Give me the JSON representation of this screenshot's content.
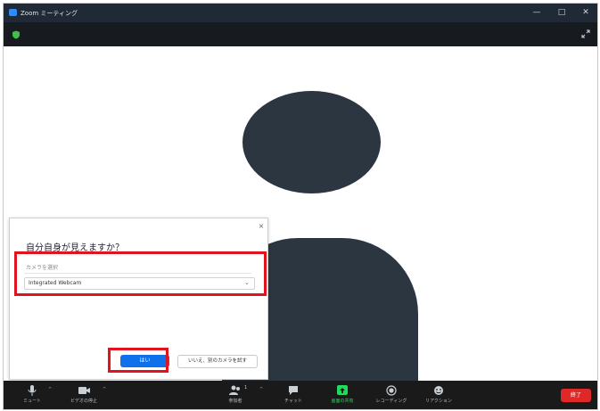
{
  "window": {
    "title": "Zoom ミーティング",
    "minimize_glyph": "—",
    "maximize_glyph": "□",
    "close_glyph": "✕"
  },
  "dialog": {
    "title": "自分自身が見えますか？",
    "select_label": "カメラを選択",
    "selected_camera": "Integrated Webcam",
    "yes_label": "はい",
    "other_camera_label": "いいえ、別のカメラを試す",
    "close_glyph": "×"
  },
  "toolbar": {
    "mute_label": "ミュート",
    "video_label": "ビデオの停止",
    "participants_label": "参加者",
    "participants_count": "1",
    "chat_label": "チャット",
    "share_label": "画面の共有",
    "record_label": "レコーディング",
    "reactions_label": "リアクション",
    "end_label": "終了"
  },
  "colors": {
    "titlebar": "#1f2a36",
    "avatar": "#2c3640",
    "primary_button": "#0e71eb",
    "highlight_box": "#e0141e",
    "share_green": "#23d959",
    "end_red": "#e02828"
  },
  "icons": [
    "app-icon",
    "shield-icon",
    "expand-icon",
    "chevron-down-icon",
    "mic-icon",
    "video-camera-icon",
    "participants-icon",
    "chat-icon",
    "share-screen-icon",
    "record-icon",
    "reactions-icon"
  ]
}
